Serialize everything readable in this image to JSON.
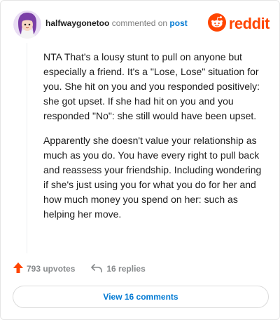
{
  "comment": {
    "author": "halfwaygonetoo",
    "verb": "commented on",
    "post_link": "post",
    "paragraphs": [
      "NTA That's a lousy stunt to pull on anyone but especially a friend. It's a \"Lose, Lose\" situation for you. She hit on you and you responded positively: she got upset. If she had hit on you and you responded \"No\": she still would have been upset.",
      "Apparently she doesn't value your relationship as much as you do. You have every right to pull back and reassess your friendship. Including wondering if she's just using you for what you do for her and how much money you spend on her: such as helping her move."
    ]
  },
  "brand": {
    "wordmark": "reddit",
    "icon": "reddit-snoo-icon",
    "color": "#ff4500"
  },
  "actions": {
    "upvotes": "793 upvotes",
    "replies": "16 replies"
  },
  "view_button": {
    "label": "View 16 comments"
  },
  "colors": {
    "accent": "#0079d3",
    "upvote": "#ff4500",
    "muted": "#878a8c"
  }
}
